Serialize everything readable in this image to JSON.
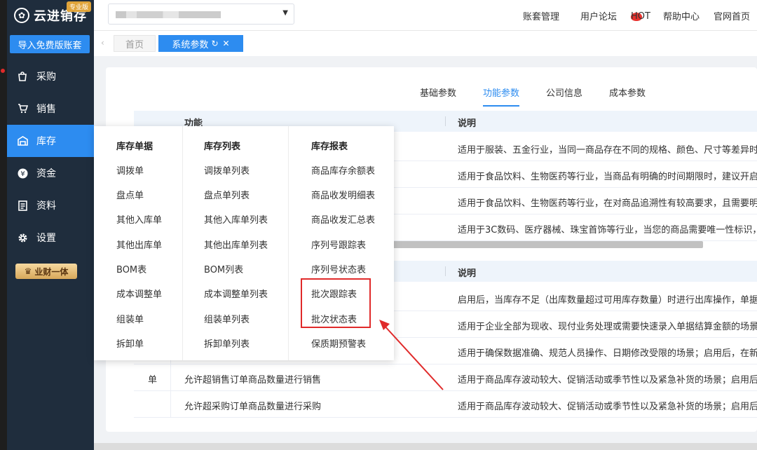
{
  "brand": {
    "name": "云进销存",
    "badge": "专业版"
  },
  "sidebar": {
    "import_button": "导入免费版账套",
    "items": [
      {
        "label": "采购",
        "icon": "bag-icon"
      },
      {
        "label": "销售",
        "icon": "cart-icon"
      },
      {
        "label": "库存",
        "icon": "warehouse-icon",
        "active": true
      },
      {
        "label": "资金",
        "icon": "yen-icon"
      },
      {
        "label": "资料",
        "icon": "document-icon"
      },
      {
        "label": "设置",
        "icon": "gear-icon"
      }
    ],
    "vip_label": "业财一体"
  },
  "header": {
    "account_select": {
      "value_blurred": true
    },
    "links": [
      "账套管理",
      "用户论坛",
      "帮助中心",
      "官网首页"
    ],
    "forum_badge": "HOT"
  },
  "tabs": [
    {
      "label": "首页"
    },
    {
      "label": "系统参数",
      "active": true
    }
  ],
  "subtabs": [
    {
      "label": "基础参数"
    },
    {
      "label": "功能参数",
      "active": true
    },
    {
      "label": "公司信息"
    },
    {
      "label": "成本参数"
    }
  ],
  "table1": {
    "headers": {
      "func": "功能",
      "desc": "说明"
    },
    "rows": [
      {
        "desc": "适用于服装、五金行业，当同一商品存在不同的规格、颜色、尺寸等差异时，建"
      },
      {
        "desc": "适用于食品饮料、生物医药等行业，当商品有明确的时间期限时，建议开启使用"
      },
      {
        "desc": "适用于食品饮料、生物医药等行业，在对商品追溯性有较高要求，且需要明确了"
      },
      {
        "desc": "适用于3C数码、医疗器械、珠宝首饰等行业，当您的商品需要唯一性标识，建议"
      }
    ]
  },
  "table2": {
    "headers": {
      "desc": "说明"
    },
    "category": "单",
    "rows": [
      {
        "func": "",
        "desc": "启用后，当库存不足（出库数量超过可用库存数量）时进行出库操作，单据允许"
      },
      {
        "func": "",
        "desc": "适用于企业全部为现收、现付业务处理或需要快速录入单据结算金额的场景；启"
      },
      {
        "func": "",
        "desc": "适用于确保数据准确、规范人员操作、日期修改受限的场景；启用后，在新增销"
      },
      {
        "func": "允许超销售订单商品数量进行销售",
        "desc": "适用于商品库存波动较大、促销活动或季节性以及紧急补货的场景；启用后，销"
      },
      {
        "func": "允许超采购订单商品数量进行采购",
        "desc": "适用于商品库存波动较大、促销活动或季节性以及紧急补货的场景；启用后，采"
      }
    ]
  },
  "dropdown": {
    "columns": [
      {
        "title": "库存单据",
        "items": [
          "调拨单",
          "盘点单",
          "其他入库单",
          "其他出库单",
          "BOM表",
          "成本调整单",
          "组装单",
          "拆卸单"
        ]
      },
      {
        "title": "库存列表",
        "items": [
          "调拨单列表",
          "盘点单列表",
          "其他入库单列表",
          "其他出库单列表",
          "BOM列表",
          "成本调整单列表",
          "组装单列表",
          "拆卸单列表"
        ]
      },
      {
        "title": "库存报表",
        "items": [
          "商品库存余额表",
          "商品收发明细表",
          "商品收发汇总表",
          "序列号跟踪表",
          "序列号状态表",
          "批次跟踪表",
          "批次状态表",
          "保质期预警表"
        ]
      }
    ]
  },
  "colors": {
    "accent": "#2d8cf0",
    "sidebar_bg": "#1f2d3d",
    "highlight": "#e02a2a"
  }
}
